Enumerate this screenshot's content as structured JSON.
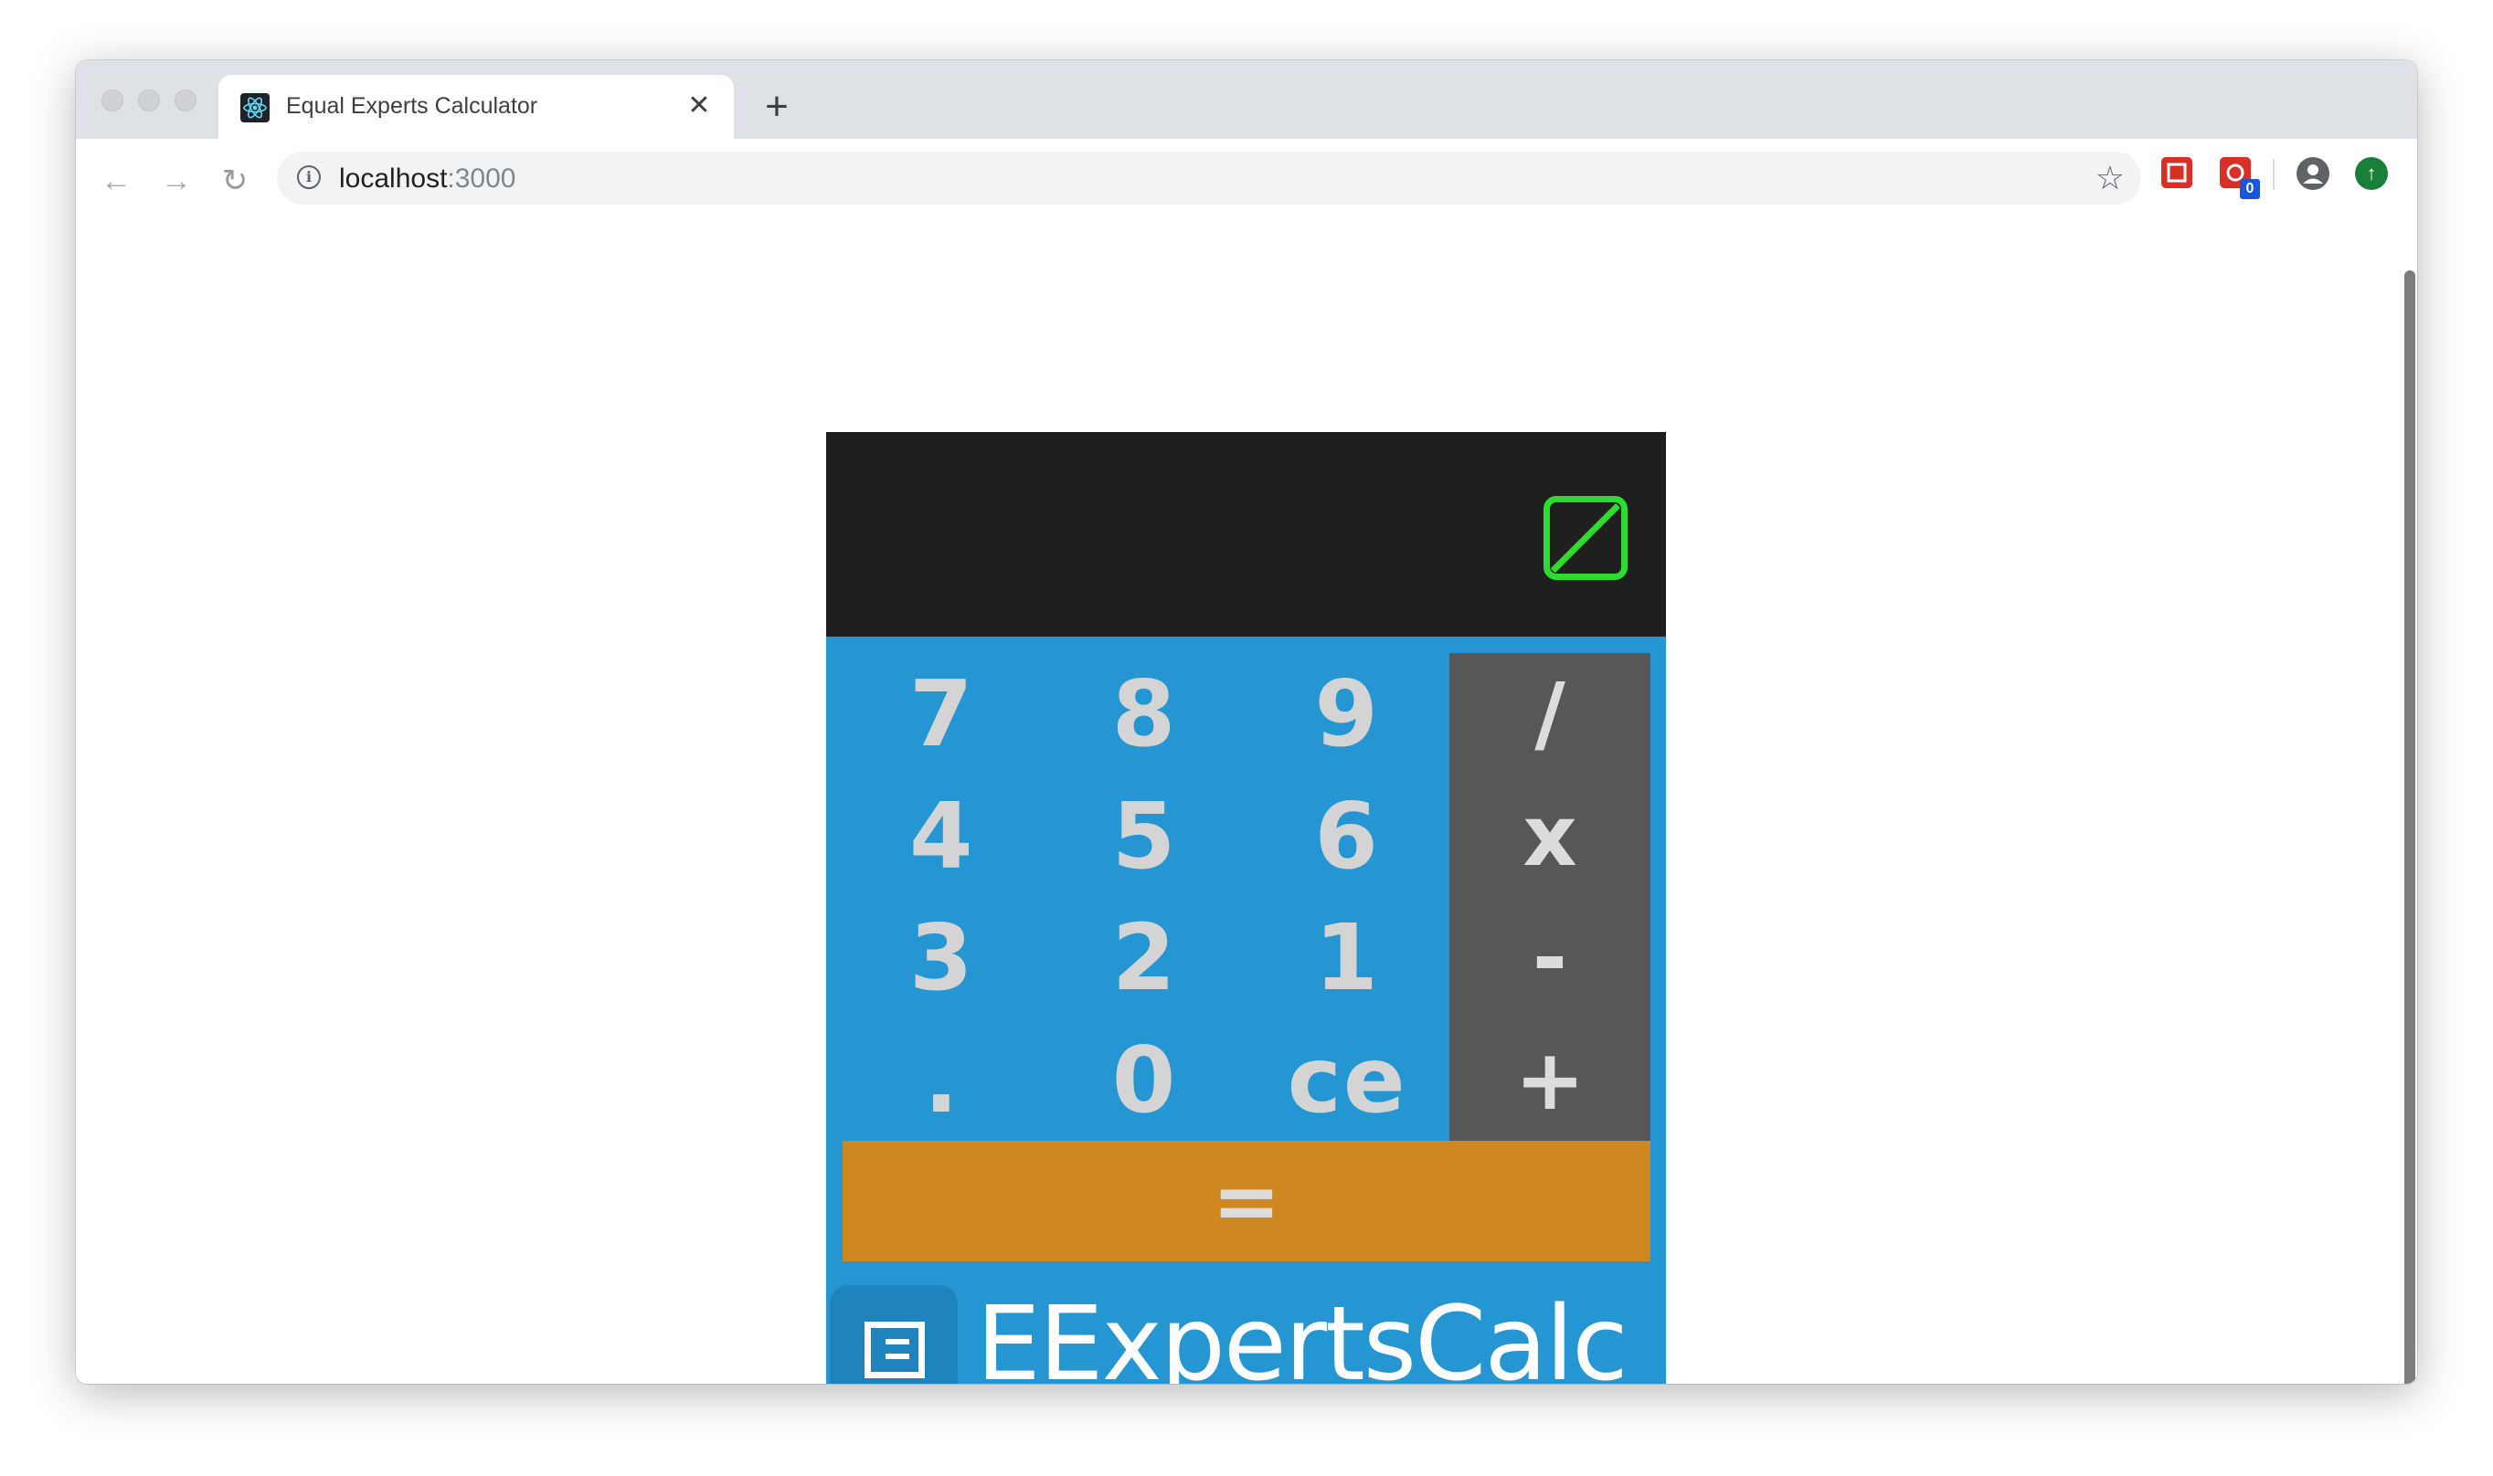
{
  "browser": {
    "tab_title": "Equal Experts Calculator",
    "tab_close": "✕",
    "new_tab": "+",
    "url_host": "localhost",
    "url_port": ":3000",
    "back_icon": "←",
    "forward_icon": "→",
    "reload_icon": "↻",
    "star_icon": "☆",
    "extension_badge": "0"
  },
  "calculator": {
    "display_value": "",
    "digit_keys": [
      "7",
      "8",
      "9",
      "4",
      "5",
      "6",
      "3",
      "2",
      "1",
      ".",
      "0",
      "ce"
    ],
    "operator_keys": [
      "/",
      "x",
      "-",
      "+"
    ],
    "equals_key": "=",
    "brand_name": "EExpertsCalc"
  },
  "colors": {
    "display_bg": "#1f1f1f",
    "display_fg": "#2ddc2d",
    "keypad_bg": "#2596d2",
    "operator_bg": "#575757",
    "equals_bg": "#cf8721",
    "key_fg": "#d4d4d4"
  }
}
